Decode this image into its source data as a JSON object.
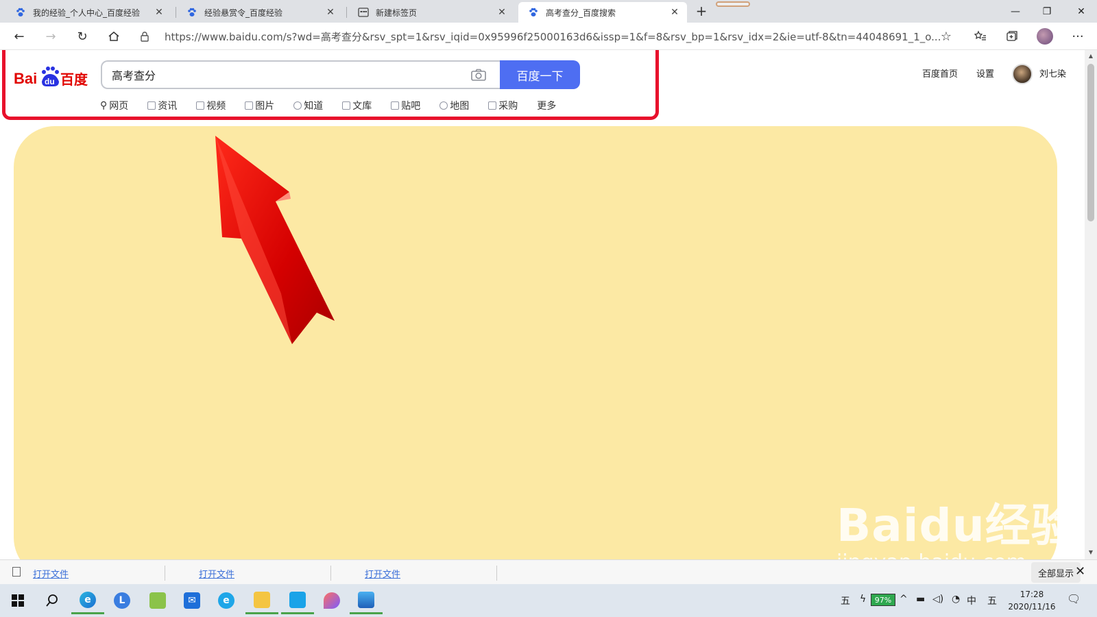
{
  "browser": {
    "tabs": [
      {
        "title": "我的经验_个人中心_百度经验",
        "active": false
      },
      {
        "title": "经验悬赏令_百度经验",
        "active": false
      },
      {
        "title": "新建标签页",
        "active": false
      },
      {
        "title": "高考查分_百度搜索",
        "active": true
      }
    ],
    "url": "https://www.baidu.com/s?wd=高考查分&rsv_spt=1&rsv_iqid=0x95996f25000163d6&issp=1&f=8&rsv_bp=1&rsv_idx=2&ie=utf-8&tn=44048691_1_o..."
  },
  "search": {
    "query": "高考查分",
    "button_label": "百度一下",
    "tabs": [
      "网页",
      "资讯",
      "视频",
      "图片",
      "知道",
      "文库",
      "贴吧",
      "地图",
      "采购",
      "更多"
    ]
  },
  "header_links": {
    "home": "百度首页",
    "settings": "设置",
    "username": "刘七染"
  },
  "logo": {
    "text_bai": "Bai",
    "text_du": "du",
    "text_cn": "百度"
  },
  "watermark": {
    "main": "Baidu经验",
    "sub": "jingyan.baidu.com"
  },
  "downloads": {
    "items": [
      "打开文件",
      "打开文件",
      "打开文件"
    ],
    "show_all": "全部显示"
  },
  "taskbar": {
    "ime": "五",
    "battery": "97%",
    "lang": "中",
    "ime2": "五",
    "time": "17:28",
    "date": "2020/11/16"
  },
  "colors": {
    "accent": "#4e6ef2",
    "highlight": "#e8102c",
    "panel": "#fce9a4",
    "arrow": "#e00000"
  }
}
